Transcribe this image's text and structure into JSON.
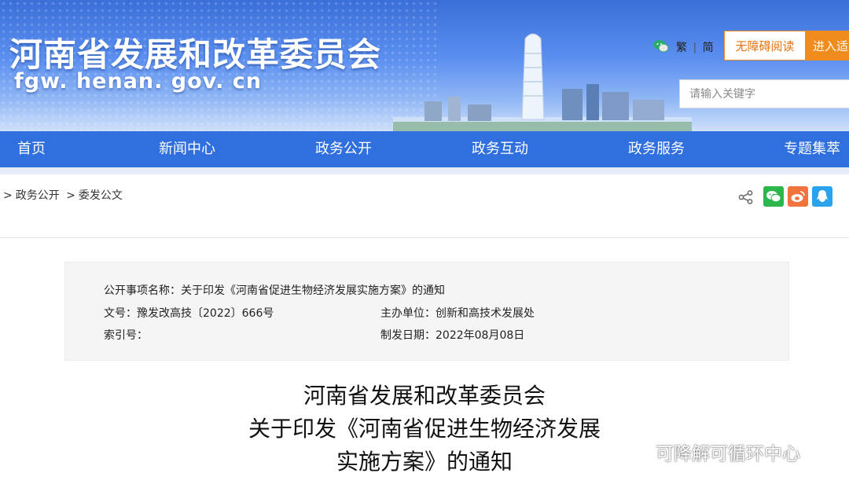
{
  "header": {
    "site_title": "河南省发展和改革委员会",
    "site_domain": "fgw. henan. gov. cn",
    "lang_traditional": "繁",
    "lang_separator": "|",
    "lang_simplified": "简",
    "accessibility_label": "无障碍阅读",
    "enter_label": "进入适",
    "search_placeholder": "请输入关键字"
  },
  "nav": {
    "items": [
      {
        "label": "首页"
      },
      {
        "label": "新闻中心"
      },
      {
        "label": "政务公开"
      },
      {
        "label": "政务互动"
      },
      {
        "label": "政务服务"
      },
      {
        "label": "专题集萃"
      }
    ],
    "color": "#2f6fde"
  },
  "breadcrumb": {
    "sep1": ">",
    "item1": "政务公开",
    "sep2": ">",
    "item2": "委发公文"
  },
  "share": {
    "icons": [
      "share-icon",
      "wechat-icon",
      "weibo-icon",
      "qq-icon"
    ]
  },
  "info": {
    "name_label": "公开事项名称：",
    "name_value": "关于印发《河南省促进生物经济发展实施方案》的通知",
    "doc_no_label": "文号：",
    "doc_no_value": "豫发改高技〔2022〕666号",
    "dept_label": "主办单位：",
    "dept_value": "创新和高技术发展处",
    "index_label": "索引号：",
    "index_value": "",
    "date_label": "制发日期：",
    "date_value": "2022年08月08日"
  },
  "document": {
    "title_line1": "河南省发展和改革委员会",
    "title_line2": "关于印发《河南省促进生物经济发展",
    "title_line3": "实施方案》的通知"
  },
  "watermark": {
    "text": "可降解可循环中心"
  }
}
